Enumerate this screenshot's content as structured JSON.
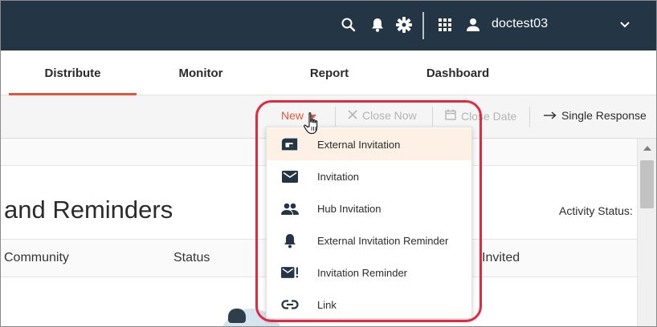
{
  "header": {
    "username": "doctest03",
    "icons": [
      "search-icon",
      "bell-icon",
      "gear-icon",
      "apps-grid-icon",
      "user-icon",
      "chevron-down-icon"
    ],
    "background": "#243646"
  },
  "tabs": [
    {
      "label": "Distribute",
      "active": true
    },
    {
      "label": "Monitor",
      "active": false
    },
    {
      "label": "Report",
      "active": false
    },
    {
      "label": "Dashboard",
      "active": false
    }
  ],
  "toolbar": {
    "new_label": "New",
    "close_now_label": "Close Now",
    "close_date_label": "Close Date",
    "single_response_label": "Single Response"
  },
  "content": {
    "heading": "and Reminders",
    "activity_status_label": "Activity Status:",
    "columns": [
      "Community",
      "Status",
      "Invited"
    ]
  },
  "dropdown": {
    "items": [
      {
        "label": "External Invitation",
        "icon": "external-mailbox-icon",
        "highlighted": true
      },
      {
        "label": "Invitation",
        "icon": "envelope-icon",
        "highlighted": false
      },
      {
        "label": "Hub Invitation",
        "icon": "people-icon",
        "highlighted": false
      },
      {
        "label": "External Invitation Reminder",
        "icon": "bell-icon",
        "highlighted": false
      },
      {
        "label": "Invitation Reminder",
        "icon": "envelope-alert-icon",
        "highlighted": false
      },
      {
        "label": "Link",
        "icon": "link-icon",
        "highlighted": false
      }
    ]
  },
  "colors": {
    "accent": "#e4563c",
    "highlight_ring": "#e4283f",
    "menu_hover": "#fdf1e6"
  }
}
